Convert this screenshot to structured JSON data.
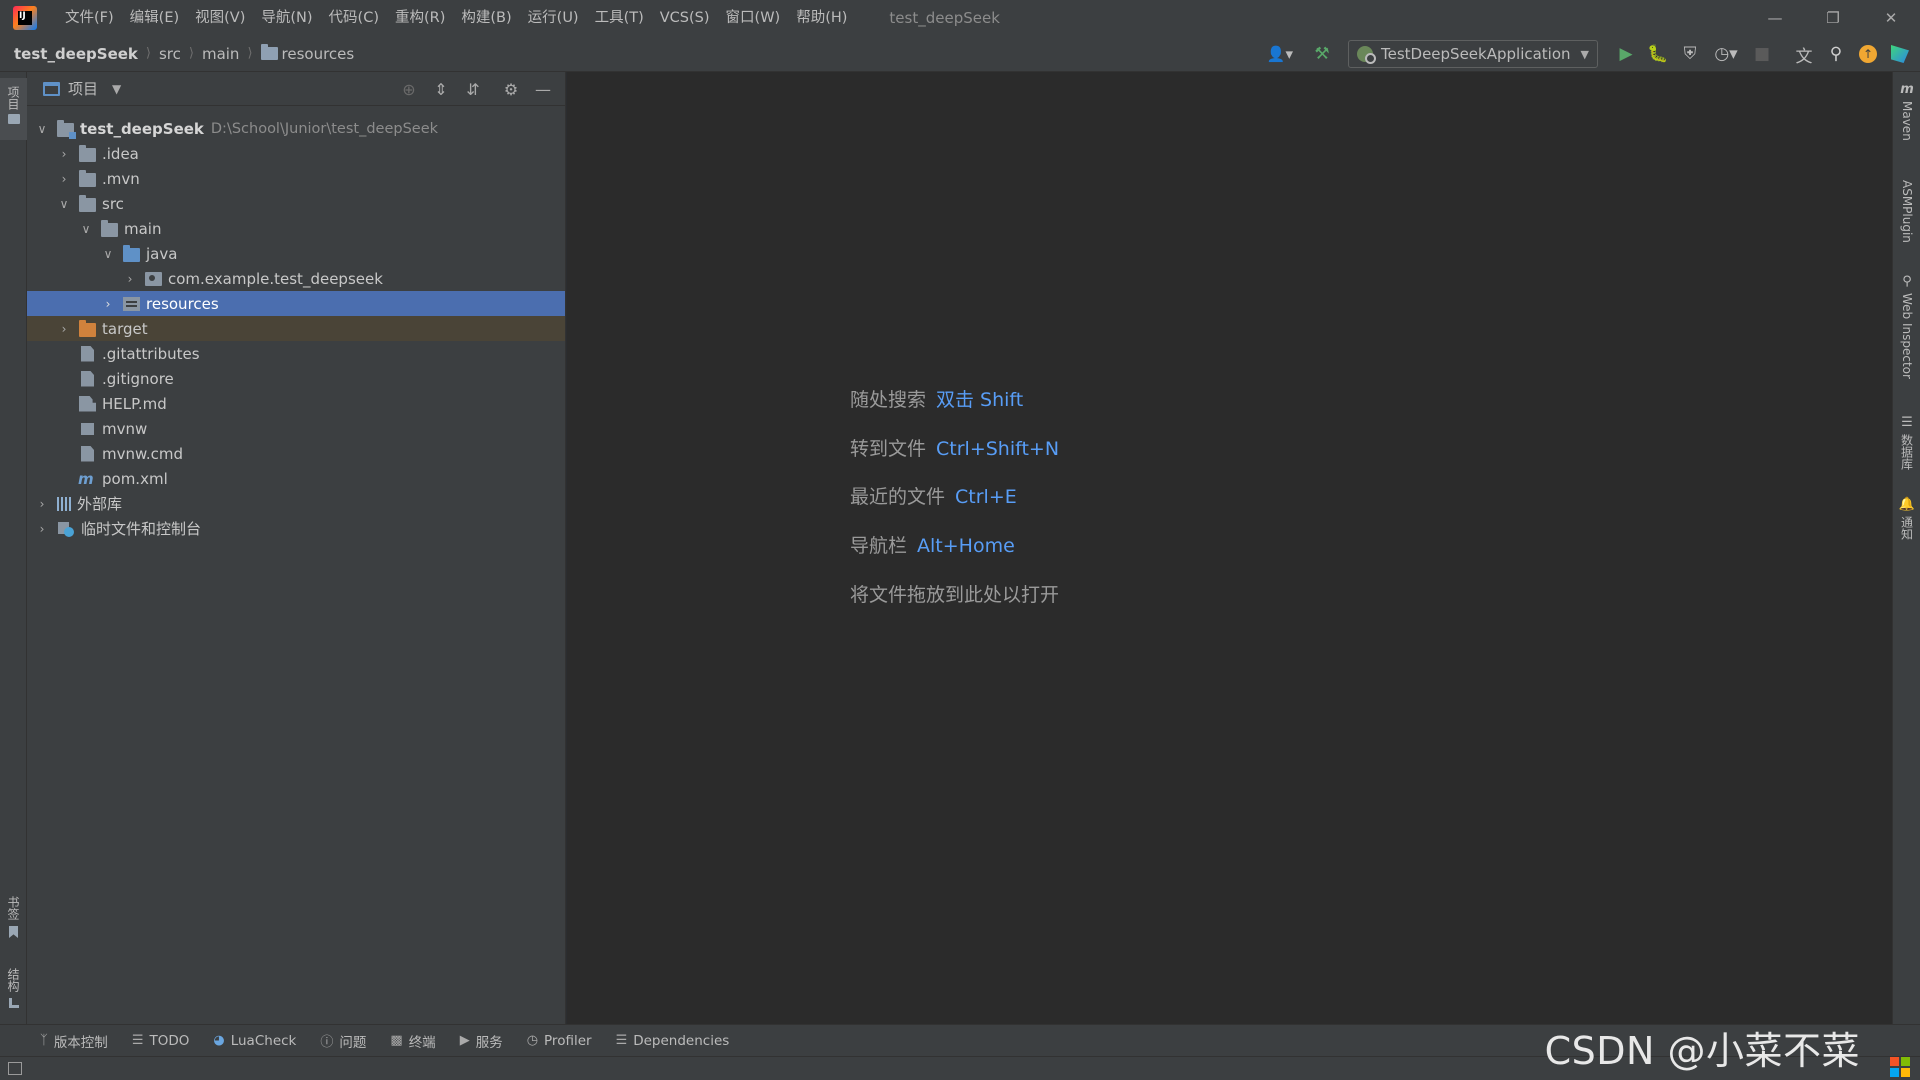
{
  "titlebar": {
    "menu": [
      "文件(F)",
      "编辑(E)",
      "视图(V)",
      "导航(N)",
      "代码(C)",
      "重构(R)",
      "构建(B)",
      "运行(U)",
      "工具(T)",
      "VCS(S)",
      "窗口(W)",
      "帮助(H)"
    ],
    "window_title": "test_deepSeek",
    "controls": [
      "minimize-icon",
      "restore-icon",
      "close-icon"
    ]
  },
  "navbar": {
    "breadcrumbs": [
      "test_deepSeek",
      "src",
      "main",
      "resources"
    ],
    "run_config": "TestDeepSeekApplication"
  },
  "left_strip": {
    "project_tab": "项目",
    "bookmarks_tab": "书签",
    "structure_tab": "结构"
  },
  "project_panel": {
    "title": "项目",
    "tree": [
      {
        "label": "test_deepSeek",
        "hint": "D:\\School\\Junior\\test_deepSeek",
        "level": 0,
        "expanded": true,
        "icon": "module-folder-icon"
      },
      {
        "label": ".idea",
        "level": 1,
        "expanded": false,
        "icon": "folder-icon"
      },
      {
        "label": ".mvn",
        "level": 1,
        "expanded": false,
        "icon": "folder-icon"
      },
      {
        "label": "src",
        "level": 1,
        "expanded": true,
        "icon": "folder-icon"
      },
      {
        "label": "main",
        "level": 2,
        "expanded": true,
        "icon": "folder-icon"
      },
      {
        "label": "java",
        "level": 3,
        "expanded": true,
        "icon": "source-folder-icon"
      },
      {
        "label": "com.example.test_deepseek",
        "level": 4,
        "expanded": false,
        "icon": "package-icon"
      },
      {
        "label": "resources",
        "level": 3,
        "expanded": false,
        "icon": "resources-folder-icon",
        "selected": true
      },
      {
        "label": "target",
        "level": 1,
        "expanded": false,
        "icon": "excluded-folder-icon"
      },
      {
        "label": ".gitattributes",
        "level": 1,
        "icon": "file-icon"
      },
      {
        "label": ".gitignore",
        "level": 1,
        "icon": "file-icon"
      },
      {
        "label": "HELP.md",
        "level": 1,
        "icon": "markdown-icon"
      },
      {
        "label": "mvnw",
        "level": 1,
        "icon": "shell-icon"
      },
      {
        "label": "mvnw.cmd",
        "level": 1,
        "icon": "file-icon"
      },
      {
        "label": "pom.xml",
        "level": 1,
        "icon": "maven-icon"
      },
      {
        "label": "外部库",
        "level": 0,
        "expanded": false,
        "icon": "library-icon"
      },
      {
        "label": "临时文件和控制台",
        "level": 0,
        "expanded": false,
        "icon": "scratch-icon"
      }
    ]
  },
  "editor": {
    "hints": [
      {
        "text": "随处搜索",
        "key": "双击 Shift"
      },
      {
        "text": "转到文件",
        "key": "Ctrl+Shift+N"
      },
      {
        "text": "最近的文件",
        "key": "Ctrl+E"
      },
      {
        "text": "导航栏",
        "key": "Alt+Home"
      },
      {
        "text": "将文件拖放到此处以打开",
        "key": ""
      }
    ]
  },
  "right_strip": [
    "Maven",
    "ASMPlugin",
    "Web Inspector",
    "数据库",
    "通知"
  ],
  "bottom_bar": [
    "版本控制",
    "TODO",
    "LuaCheck",
    "问题",
    "终端",
    "服务",
    "Profiler",
    "Dependencies"
  ],
  "watermark": "CSDN @小菜不菜",
  "colors": {
    "accent": "#4b6eaf",
    "shortcut_key": "#589df6",
    "editor_bg": "#2b2b2b",
    "panel_bg": "#3c3f41",
    "excluded_row": "#4a4437",
    "run_green": "#59a869"
  }
}
